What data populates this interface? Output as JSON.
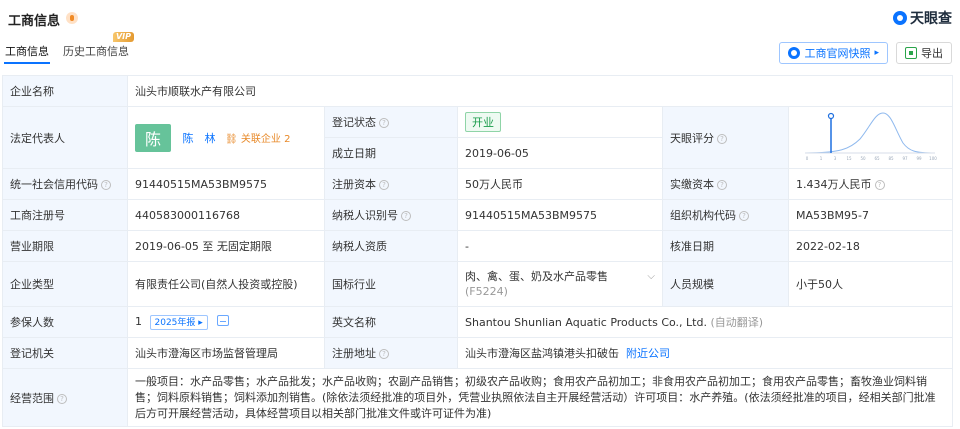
{
  "header": {
    "title": "工商信息",
    "brand": "天眼查"
  },
  "tabs": [
    {
      "label": "工商信息",
      "active": true
    },
    {
      "label": "历史工商信息",
      "badge": "VIP"
    }
  ],
  "toolbar": {
    "snapshot_label": "工商官网快照",
    "export_label": "导出"
  },
  "info": {
    "company_name": {
      "label": "企业名称",
      "value": "汕头市顺联水产有限公司"
    },
    "legal_rep": {
      "label": "法定代表人",
      "avatar_char": "陈",
      "name": "陈　林",
      "related_label": "关联企业",
      "related_count": "2"
    },
    "reg_status": {
      "label": "登记状态",
      "value": "开业"
    },
    "established": {
      "label": "成立日期",
      "value": "2019-06-05"
    },
    "score": {
      "label": "天眼评分",
      "axis_ticks": [
        "0",
        "1",
        "3",
        "15",
        "50",
        "65",
        "85",
        "97",
        "99",
        "100"
      ]
    },
    "credit_code": {
      "label": "统一社会信用代码",
      "value": "91440515MA53BM9575"
    },
    "reg_capital": {
      "label": "注册资本",
      "value": "50万人民币"
    },
    "paid_capital": {
      "label": "实缴资本",
      "value": "1.434万人民币"
    },
    "reg_number": {
      "label": "工商注册号",
      "value": "440583000116768"
    },
    "taxpayer_id": {
      "label": "纳税人识别号",
      "value": "91440515MA53BM9575"
    },
    "org_code": {
      "label": "组织机构代码",
      "value": "MA53BM95-7"
    },
    "term": {
      "label": "营业期限",
      "value": "2019-06-05 至 无固定期限"
    },
    "taxpayer_qual": {
      "label": "纳税人资质",
      "value": "-"
    },
    "approval_date": {
      "label": "核准日期",
      "value": "2022-02-18"
    },
    "company_type": {
      "label": "企业类型",
      "value": "有限责任公司(自然人投资或控股)"
    },
    "industry": {
      "label": "国标行业",
      "value": "肉、禽、蛋、奶及水产品零售",
      "code": "(F5224)"
    },
    "staff_size": {
      "label": "人员规模",
      "value": "小于50人"
    },
    "insured": {
      "label": "参保人数",
      "value": "1",
      "report_tag": "2025年报"
    },
    "english_name": {
      "label": "英文名称",
      "value": "Shantou Shunlian Aquatic Products Co., Ltd.",
      "note": "(自动翻译)"
    },
    "reg_authority": {
      "label": "登记机关",
      "value": "汕头市澄海区市场监督管理局"
    },
    "reg_address": {
      "label": "注册地址",
      "value": "汕头市澄海区盐鸿镇港头扣破缶",
      "nearby": "附近公司"
    },
    "scope": {
      "label": "经营范围",
      "value": "一般项目：水产品零售；水产品批发；水产品收购；农副产品销售；初级农产品收购；食用农产品初加工；非食用农产品初加工；食用农产品零售；畜牧渔业饲料销售；饲料原料销售；饲料添加剂销售。(除依法须经批准的项目外，凭营业执照依法自主开展经营活动）许可项目：水产养殖。(依法须经批准的项目，经相关部门批准后方可开展经营活动，具体经营项目以相关部门批准文件或许可证件为准)"
    }
  },
  "colors": {
    "accent": "#0a73ff",
    "key_bg": "#f2f7fe",
    "status_green": "#1a9c4b",
    "avatar_green": "#66c39a"
  }
}
